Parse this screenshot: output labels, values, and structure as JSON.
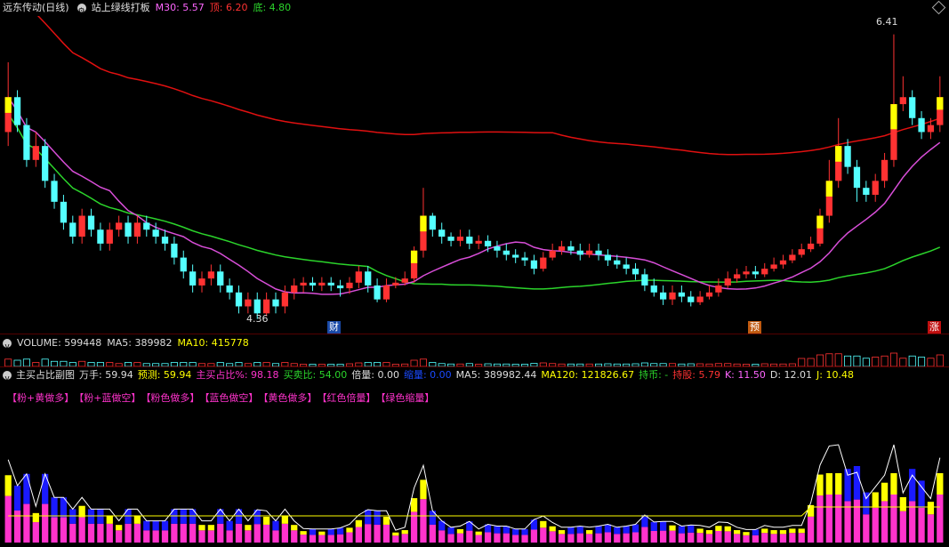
{
  "header": {
    "stock_title": "远东传动(日线)",
    "indicator": "站上绿线打板",
    "m30": "M30: 5.57",
    "top": "顶: 6.20",
    "bottom": "底: 4.80"
  },
  "price_labels": {
    "high": "6.41",
    "low": "4.36"
  },
  "event_badges": [
    "财",
    "预",
    "涨"
  ],
  "volume_bar": {
    "title": "VOLUME: 599448",
    "ma5": "MA5: 389982",
    "ma10": "MA10: 415778"
  },
  "sub_chart": {
    "title": "主买占比副图",
    "wanshou": "万手: 59.94",
    "yuce": "预测: 59.94",
    "zhumai": "主买占比%: 98.18",
    "maimai": "买卖比: 54.00",
    "beiliang": "倍量: 0.00",
    "suoliang": "缩量: 0.00",
    "ma5": "MA5: 389982.44",
    "ma120": "MA120: 121826.67",
    "chibi": "持币: -",
    "chigu": "持股: 5.79",
    "k": "K: 11.50",
    "d": "D: 12.01",
    "j": "J: 10.48"
  },
  "legend_tags": [
    "【粉+黄做多】",
    "【粉+蓝做空】",
    "【粉色做多】",
    "【蓝色做空】",
    "【黄色做多】",
    "【红色倍量】",
    "【绿色缩量】"
  ],
  "colors": {
    "up": "#ff3232",
    "down": "#54ffff",
    "ma_green": "#2bd42b",
    "ma_magenta": "#d84ed8",
    "top_red": "#e01010",
    "yellow": "#ffff00",
    "blue": "#1a1aff",
    "pink": "#ff33cc"
  },
  "chart_data": {
    "type": "candlestick",
    "candles": [
      [
        5.7,
        5.95,
        6.2,
        5.6
      ],
      [
        5.95,
        5.75,
        6.0,
        5.7
      ],
      [
        5.75,
        5.5,
        5.8,
        5.45
      ],
      [
        5.5,
        5.6,
        5.7,
        5.45
      ],
      [
        5.6,
        5.35,
        5.65,
        5.3
      ],
      [
        5.35,
        5.2,
        5.4,
        5.15
      ],
      [
        5.2,
        5.05,
        5.25,
        5.0
      ],
      [
        5.05,
        4.95,
        5.1,
        4.9
      ],
      [
        4.95,
        5.1,
        5.15,
        4.9
      ],
      [
        5.1,
        5.0,
        5.15,
        4.95
      ],
      [
        5.0,
        4.9,
        5.05,
        4.85
      ],
      [
        4.9,
        5.0,
        5.05,
        4.85
      ],
      [
        5.0,
        5.05,
        5.1,
        4.95
      ],
      [
        5.05,
        4.95,
        5.1,
        4.9
      ],
      [
        4.95,
        5.05,
        5.1,
        4.9
      ],
      [
        5.05,
        5.0,
        5.1,
        4.95
      ],
      [
        5.0,
        4.95,
        5.05,
        4.9
      ],
      [
        4.95,
        4.9,
        5.0,
        4.85
      ],
      [
        4.9,
        4.8,
        4.95,
        4.75
      ],
      [
        4.8,
        4.7,
        4.85,
        4.65
      ],
      [
        4.7,
        4.6,
        4.75,
        4.55
      ],
      [
        4.6,
        4.65,
        4.7,
        4.55
      ],
      [
        4.65,
        4.7,
        4.75,
        4.6
      ],
      [
        4.7,
        4.6,
        4.75,
        4.55
      ],
      [
        4.6,
        4.55,
        4.65,
        4.5
      ],
      [
        4.55,
        4.45,
        4.6,
        4.4
      ],
      [
        4.45,
        4.5,
        4.55,
        4.4
      ],
      [
        4.5,
        4.4,
        4.55,
        4.36
      ],
      [
        4.4,
        4.5,
        4.55,
        4.38
      ],
      [
        4.5,
        4.45,
        4.55,
        4.4
      ],
      [
        4.45,
        4.55,
        4.6,
        4.4
      ],
      [
        4.55,
        4.6,
        4.65,
        4.5
      ],
      [
        4.6,
        4.62,
        4.66,
        4.55
      ],
      [
        4.62,
        4.6,
        4.66,
        4.56
      ],
      [
        4.6,
        4.62,
        4.66,
        4.56
      ],
      [
        4.62,
        4.6,
        4.66,
        4.56
      ],
      [
        4.6,
        4.58,
        4.64,
        4.52
      ],
      [
        4.58,
        4.62,
        4.66,
        4.54
      ],
      [
        4.62,
        4.7,
        4.74,
        4.58
      ],
      [
        4.7,
        4.6,
        4.74,
        4.55
      ],
      [
        4.6,
        4.5,
        4.65,
        4.48
      ],
      [
        4.5,
        4.6,
        4.65,
        4.48
      ],
      [
        4.6,
        4.62,
        4.66,
        4.58
      ],
      [
        4.62,
        4.65,
        4.7,
        4.6
      ],
      [
        4.65,
        4.85,
        4.88,
        4.62
      ],
      [
        4.85,
        5.1,
        5.3,
        4.8
      ],
      [
        5.1,
        5.0,
        5.12,
        4.95
      ],
      [
        5.0,
        4.95,
        5.05,
        4.9
      ],
      [
        4.95,
        4.92,
        4.98,
        4.88
      ],
      [
        4.92,
        4.95,
        5.0,
        4.88
      ],
      [
        4.95,
        4.9,
        5.0,
        4.86
      ],
      [
        4.9,
        4.92,
        4.96,
        4.86
      ],
      [
        4.92,
        4.88,
        4.96,
        4.84
      ],
      [
        4.88,
        4.85,
        4.92,
        4.8
      ],
      [
        4.85,
        4.82,
        4.9,
        4.78
      ],
      [
        4.82,
        4.8,
        4.86,
        4.76
      ],
      [
        4.8,
        4.78,
        4.84,
        4.74
      ],
      [
        4.78,
        4.72,
        4.82,
        4.68
      ],
      [
        4.72,
        4.8,
        4.84,
        4.7
      ],
      [
        4.8,
        4.85,
        4.9,
        4.78
      ],
      [
        4.85,
        4.88,
        4.92,
        4.82
      ],
      [
        4.88,
        4.85,
        4.92,
        4.82
      ],
      [
        4.85,
        4.82,
        4.9,
        4.78
      ],
      [
        4.82,
        4.85,
        4.9,
        4.8
      ],
      [
        4.85,
        4.82,
        4.9,
        4.78
      ],
      [
        4.82,
        4.78,
        4.86,
        4.74
      ],
      [
        4.78,
        4.75,
        4.82,
        4.72
      ],
      [
        4.75,
        4.72,
        4.8,
        4.68
      ],
      [
        4.72,
        4.68,
        4.76,
        4.64
      ],
      [
        4.68,
        4.6,
        4.72,
        4.56
      ],
      [
        4.6,
        4.55,
        4.65,
        4.52
      ],
      [
        4.55,
        4.5,
        4.6,
        4.46
      ],
      [
        4.5,
        4.55,
        4.6,
        4.46
      ],
      [
        4.55,
        4.52,
        4.6,
        4.48
      ],
      [
        4.52,
        4.48,
        4.56,
        4.45
      ],
      [
        4.48,
        4.52,
        4.56,
        4.46
      ],
      [
        4.52,
        4.55,
        4.6,
        4.5
      ],
      [
        4.55,
        4.6,
        4.65,
        4.52
      ],
      [
        4.6,
        4.65,
        4.7,
        4.58
      ],
      [
        4.65,
        4.68,
        4.72,
        4.62
      ],
      [
        4.68,
        4.7,
        4.74,
        4.65
      ],
      [
        4.7,
        4.68,
        4.74,
        4.65
      ],
      [
        4.68,
        4.72,
        4.76,
        4.66
      ],
      [
        4.72,
        4.75,
        4.8,
        4.7
      ],
      [
        4.75,
        4.78,
        4.82,
        4.72
      ],
      [
        4.78,
        4.82,
        4.86,
        4.76
      ],
      [
        4.82,
        4.86,
        4.9,
        4.8
      ],
      [
        4.86,
        4.9,
        4.95,
        4.84
      ],
      [
        4.9,
        5.1,
        5.15,
        4.88
      ],
      [
        5.1,
        5.35,
        5.5,
        5.05
      ],
      [
        5.35,
        5.6,
        5.8,
        5.3
      ],
      [
        5.6,
        5.45,
        5.65,
        5.4
      ],
      [
        5.45,
        5.3,
        5.5,
        5.2
      ],
      [
        5.3,
        5.25,
        5.35,
        5.2
      ],
      [
        5.25,
        5.35,
        5.4,
        5.2
      ],
      [
        5.35,
        5.5,
        5.55,
        5.3
      ],
      [
        5.5,
        5.9,
        6.4,
        5.45
      ],
      [
        5.9,
        5.95,
        6.1,
        5.85
      ],
      [
        5.95,
        5.8,
        6.0,
        5.75
      ],
      [
        5.8,
        5.7,
        5.85,
        5.65
      ],
      [
        5.7,
        5.75,
        5.8,
        5.65
      ],
      [
        5.75,
        5.95,
        6.1,
        5.7
      ]
    ],
    "annotations": [
      "6.41",
      "4.36"
    ]
  }
}
